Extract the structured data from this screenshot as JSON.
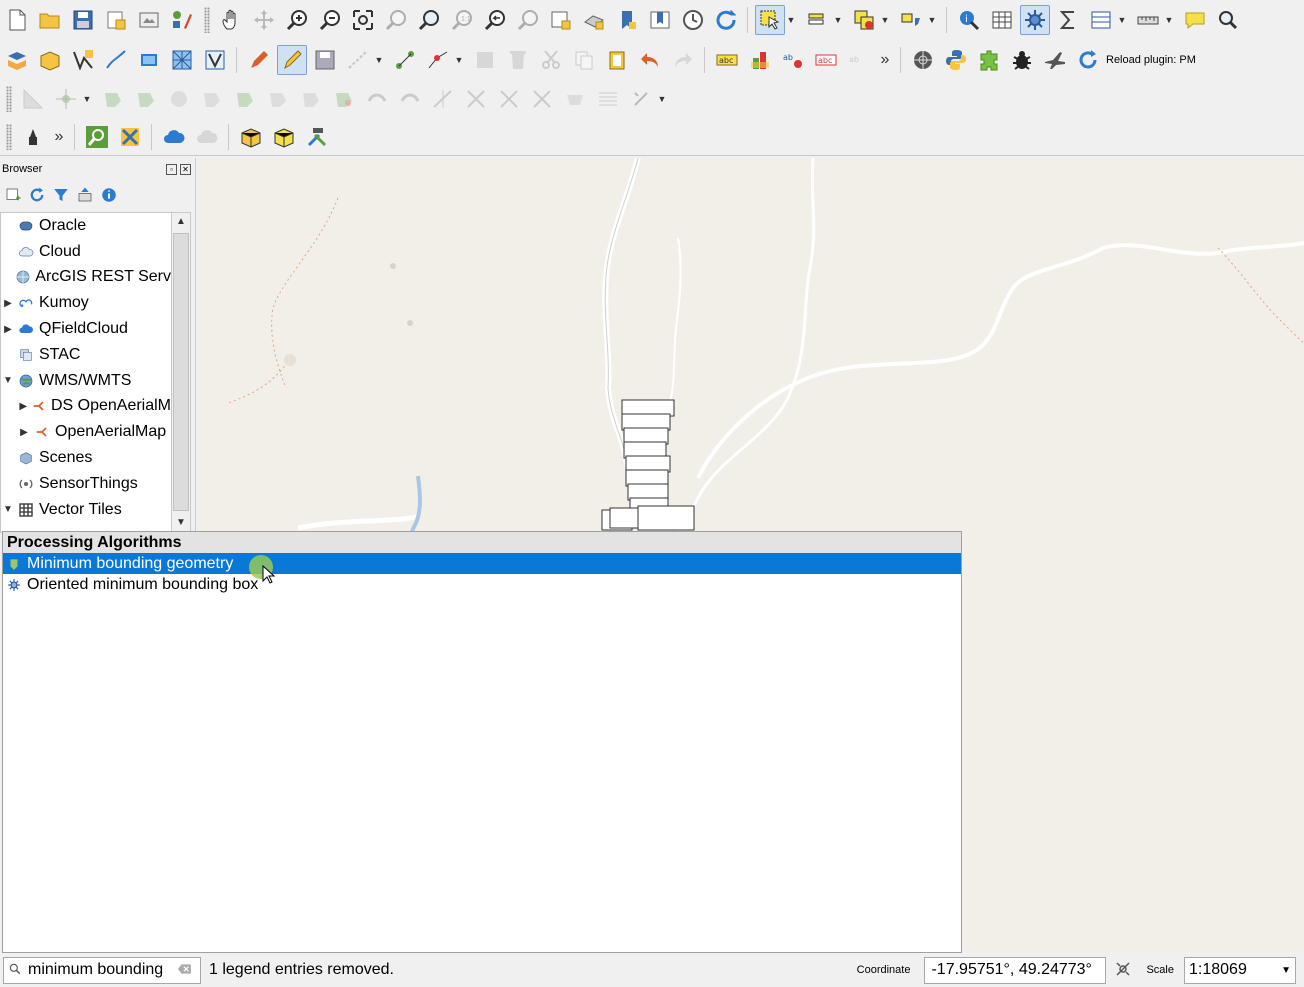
{
  "toolbar_row1": {
    "icons": [
      "new-project-icon",
      "open-project-icon",
      "save-project-icon",
      "save-as-icon",
      "print-layout-icon",
      "style-manager-icon",
      "pan-hand-icon",
      "pan-selection-icon",
      "zoom-in-icon",
      "zoom-out-icon",
      "zoom-full-icon",
      "zoom-selection-icon",
      "zoom-layer-icon",
      "zoom-native-icon",
      "zoom-last-icon",
      "zoom-next-icon",
      "new-map-view-icon",
      "new-3d-view-icon",
      "new-bookmark-icon",
      "show-bookmarks-icon",
      "temporal-controller-icon",
      "refresh-icon",
      "select-features-icon",
      "select-by-value-icon",
      "deselect-icon",
      "select-by-location-icon",
      "identify-icon",
      "attribute-table-icon",
      "processing-toolbox-icon",
      "statistics-icon",
      "open-field-calc-icon",
      "measure-icon",
      "map-tips-icon",
      "locator-icon"
    ]
  },
  "toolbar_row2": {
    "reload_label": "Reload plugin: PM"
  },
  "browser": {
    "title": "Browser",
    "items": [
      {
        "label": "Oracle",
        "icon": "oracle-icon",
        "expandable": false,
        "expanded": false,
        "indent": 0
      },
      {
        "label": "Cloud",
        "icon": "cloud-icon",
        "expandable": false,
        "expanded": false,
        "indent": 0
      },
      {
        "label": "ArcGIS REST Serv",
        "icon": "arcgis-icon",
        "expandable": false,
        "expanded": false,
        "indent": 0
      },
      {
        "label": "Kumoy",
        "icon": "kumoy-icon",
        "expandable": true,
        "expanded": false,
        "indent": 0
      },
      {
        "label": "QFieldCloud",
        "icon": "qfieldcloud-icon",
        "expandable": true,
        "expanded": false,
        "indent": 0
      },
      {
        "label": "STAC",
        "icon": "stac-icon",
        "expandable": false,
        "expanded": false,
        "indent": 0
      },
      {
        "label": "WMS/WMTS",
        "icon": "wms-globe-icon",
        "expandable": true,
        "expanded": true,
        "indent": 0
      },
      {
        "label": "DS OpenAerialM",
        "icon": "wms-connection-icon",
        "expandable": true,
        "expanded": false,
        "indent": 1
      },
      {
        "label": "OpenAerialMap",
        "icon": "wms-connection-icon",
        "expandable": true,
        "expanded": false,
        "indent": 1
      },
      {
        "label": "Scenes",
        "icon": "scenes-icon",
        "expandable": false,
        "expanded": false,
        "indent": 0
      },
      {
        "label": "SensorThings",
        "icon": "sensorthings-icon",
        "expandable": false,
        "expanded": false,
        "indent": 0
      },
      {
        "label": "Vector Tiles",
        "icon": "vector-tiles-icon",
        "expandable": true,
        "expanded": true,
        "indent": 0
      }
    ]
  },
  "processing": {
    "header": "Processing Algorithms",
    "results": [
      {
        "label": "Minimum bounding geometry",
        "icon": "algorithm-qgis-icon",
        "selected": true
      },
      {
        "label": "Oriented minimum bounding box",
        "icon": "algorithm-gear-icon",
        "selected": false
      }
    ]
  },
  "statusbar": {
    "search_value": "minimum bounding",
    "message": "1 legend entries removed.",
    "coordinate_label": "Coordinate",
    "coordinate_value": "-17.95751°, 49.24773°",
    "scale_label": "Scale",
    "scale_value": "1:18069"
  }
}
